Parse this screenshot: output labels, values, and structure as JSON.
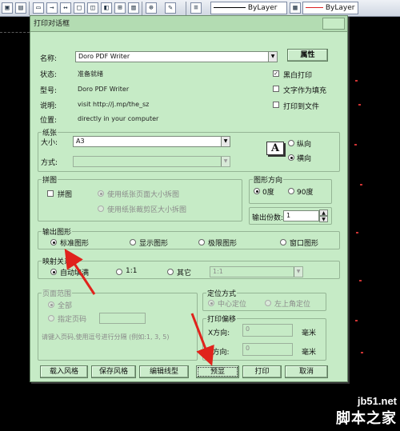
{
  "toolbar": {
    "linetype_label": "ByLayer",
    "color_label": "ByLayer"
  },
  "dialog": {
    "title": "打印对话框",
    "printer": {
      "name_label": "名称:",
      "name_value": "Doro PDF Writer",
      "properties_button": "属性",
      "status_label": "状态:",
      "status_value": "准备就绪",
      "model_label": "型号:",
      "model_value": "Doro PDF Writer",
      "desc_label": "说明:",
      "desc_value": "visit http://j.mp/the_sz",
      "location_label": "位置:",
      "location_value": "directly in your computer",
      "bw_print": "黑白打印",
      "text_as_fill": "文字作为填充",
      "print_to_file": "打印到文件"
    },
    "paper": {
      "group_title": "纸张",
      "size_label": "大小:",
      "size_value": "A3",
      "mode_label": "方式:",
      "mode_value": "",
      "portrait": "纵向",
      "landscape": "横向"
    },
    "tiling": {
      "group_title": "拼图",
      "tile_check": "拼图",
      "use_page_size": "使用纸张页面大小拆图",
      "use_clip_size": "使用纸张裁剪区大小拆图"
    },
    "orientation": {
      "group_title": "图形方向",
      "deg0": "0度",
      "deg90": "90度",
      "copies_label": "输出份数:",
      "copies_value": "1"
    },
    "output": {
      "group_title": "输出图形",
      "standard": "标准图形",
      "display": "显示图形",
      "limits": "极限图形",
      "window": "窗口图形"
    },
    "scale": {
      "group_title": "映射关系",
      "auto_fill": "自动填满",
      "one_to_one": "1:1",
      "other": "其它",
      "other_value": "1:1"
    },
    "pages": {
      "group_title": "页面范围",
      "all": "全部",
      "specify": "指定页码",
      "hint": "请键入页码,使用逗号进行分隔 (例如:1, 3, 5)"
    },
    "positioning": {
      "group_title": "定位方式",
      "center": "中心定位",
      "upper_left": "左上角定位"
    },
    "offset": {
      "group_title": "打印偏移",
      "x_label": "X方向:",
      "x_value": "0",
      "y_label": "Y方向:",
      "y_value": "0",
      "unit": "毫米"
    },
    "buttons": {
      "load_style": "载入风格",
      "save_style": "保存风格",
      "edit_linetype": "编辑线型",
      "preview": "预显",
      "print": "打印",
      "cancel": "取消"
    }
  },
  "watermark": {
    "url": "jb51.net",
    "name": "脚本之家"
  },
  "colors": {
    "dialog_bg": "#c6ebc6",
    "annotation_red": "#e0231c"
  }
}
